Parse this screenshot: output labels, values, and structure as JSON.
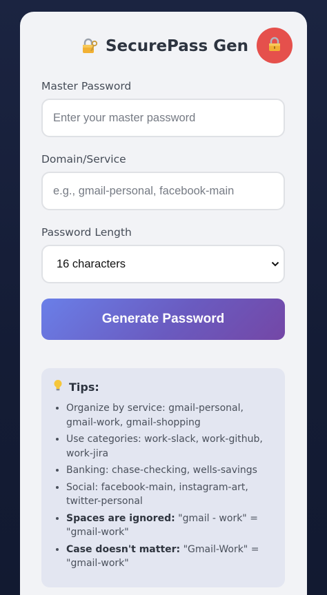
{
  "header": {
    "title": "SecurePass Gen",
    "title_icon": "lock-with-key-icon",
    "lock_button_icon": "lock-icon",
    "accent_color": "#e5504c"
  },
  "form": {
    "master_label": "Master Password",
    "master_placeholder": "Enter your master password",
    "domain_label": "Domain/Service",
    "domain_placeholder": "e.g., gmail-personal, facebook-main",
    "length_label": "Password Length",
    "length_selected": "16 characters",
    "generate_label": "Generate Password"
  },
  "tips": {
    "icon": "lightbulb-icon",
    "heading": "Tips:",
    "items": [
      {
        "bold": "",
        "text": "Organize by service: gmail-personal, gmail-work, gmail-shopping"
      },
      {
        "bold": "",
        "text": "Use categories: work-slack, work-github, work-jira"
      },
      {
        "bold": "",
        "text": "Banking: chase-checking, wells-savings"
      },
      {
        "bold": "",
        "text": "Social: facebook-main, instagram-art, twitter-personal"
      },
      {
        "bold": "Spaces are ignored:",
        "text": " \"gmail - work\" = \"gmail-work\""
      },
      {
        "bold": "Case doesn't matter:",
        "text": " \"Gmail-Work\" = \"gmail-work\""
      }
    ]
  }
}
